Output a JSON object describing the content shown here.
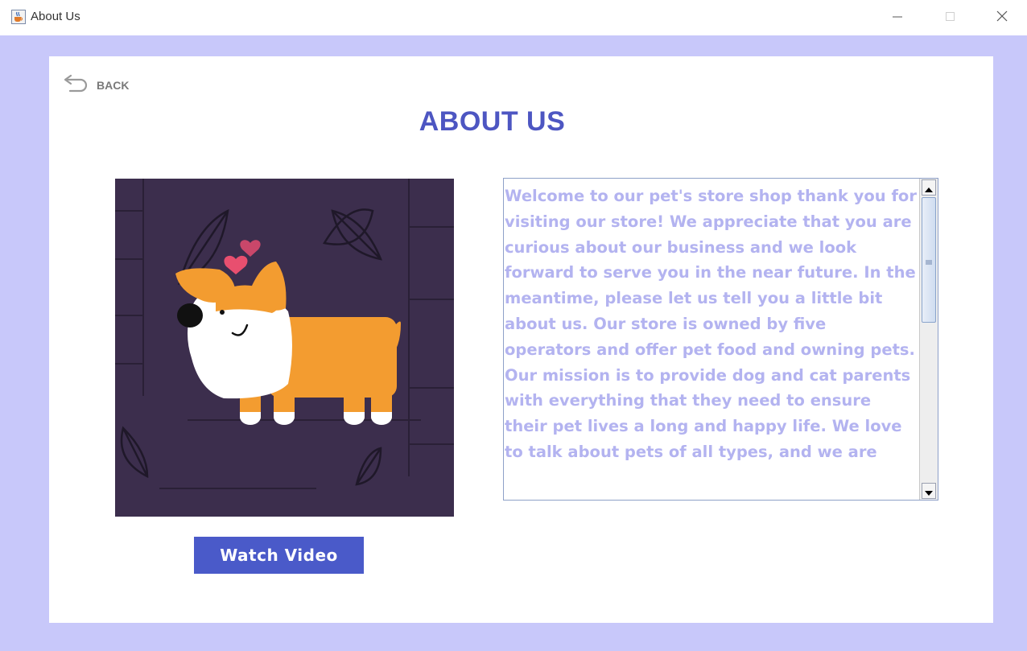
{
  "window": {
    "title": "About Us",
    "icon": "java-cup-icon"
  },
  "header": {
    "back_label": "BACK",
    "back_icon": "return-arrow-icon",
    "title": "ABOUT US"
  },
  "media": {
    "illustration": "corgi-dog-illustration",
    "watch_button_label": "Watch Video"
  },
  "about": {
    "text": "Welcome to our pet's store shop thank you for visiting our store! We appreciate that you are curious about our business and we look forward to serve you in the near future. In the meantime, please let us tell you a little bit about us. Our store is owned by five operators and offer pet food and owning pets. Our mission is to provide dog and cat parents with everything that they need to ensure their pet lives a long and happy life. We love to talk about pets of all types, and we are"
  },
  "colors": {
    "frame_background": "#c8c8fa",
    "title_color": "#4d56c2",
    "button_background": "#4a5ac9",
    "text_color": "#b3b3f0",
    "illustration_background": "#3c2e4d"
  }
}
